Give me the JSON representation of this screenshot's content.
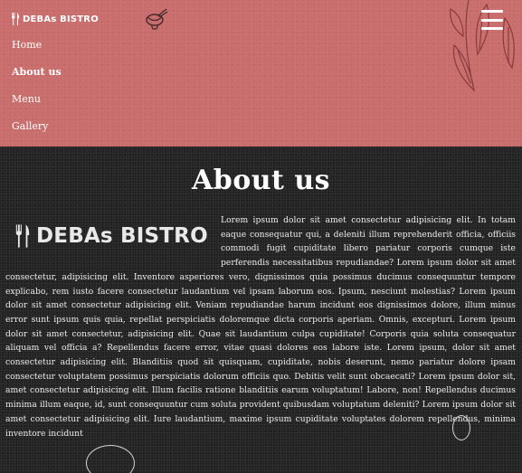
{
  "header": {
    "brand": "DEBAs BISTRO",
    "icons": [
      "utensils-icon",
      "noodle-bowl-icon",
      "leaf-decoration-icon",
      "hamburger-menu-icon"
    ],
    "background_color": "#c96d6d"
  },
  "nav": {
    "items": [
      {
        "label": "Home",
        "active": false
      },
      {
        "label": "About us",
        "active": true
      },
      {
        "label": "Menu",
        "active": false
      },
      {
        "label": "Gallery",
        "active": false
      }
    ]
  },
  "about": {
    "title": "About us",
    "logo_text": "DEBAs BISTRO",
    "text": "Lorem ipsum dolor sit amet consectetur adipisicing elit. In totam eaque consequatur qui, a deleniti illum reprehenderit officia, officiis commodi fugit cupiditate libero pariatur corporis cumque iste perferendis necessitatibus repudiandae? Lorem ipsum dolor sit amet consectetur, adipisicing elit. Inventore asperiores vero, dignissimos quia possimus ducimus consequuntur tempore explicabo, rem iusto facere consectetur laudantium vel ipsam laborum eos. Ipsum, nesciunt molestias? Lorem ipsum dolor sit amet consectetur adipisicing elit. Veniam repudiandae harum incidunt eos dignissimos dolore, illum minus error sunt ipsum quis quia, repellat perspiciatis doloremque dicta corporis aperiam. Omnis, excepturi. Lorem ipsum dolor sit amet consectetur, adipisicing elit. Quae sit laudantium culpa cupiditate! Corporis quia soluta consequatur aliquam vel officia a? Repellendus facere error, vitae quasi dolores eos labore iste. Lorem ipsum, dolor sit amet consectetur adipisicing elit. Blanditiis quod sit quisquam, cupiditate, nobis deserunt, nemo pariatur dolore ipsam consectetur voluptatem possimus perspiciatis dolorum officiis quo. Debitis velit sunt obcaecati? Lorem ipsum dolor sit, amet consectetur adipisicing elit. Illum facilis ratione blanditiis earum voluptatum! Labore, non! Repellendus ducimus minima illum eaque, id, sunt consequuntur cum soluta provident quibusdam voluptatum deleniti? Lorem ipsum dolor sit amet consectetur adipisicing elit. Iure laudantium, maxime ipsum cupiditate voluptates dolorem repellendus, minima inventore incidunt",
    "background_color": "#232323"
  }
}
